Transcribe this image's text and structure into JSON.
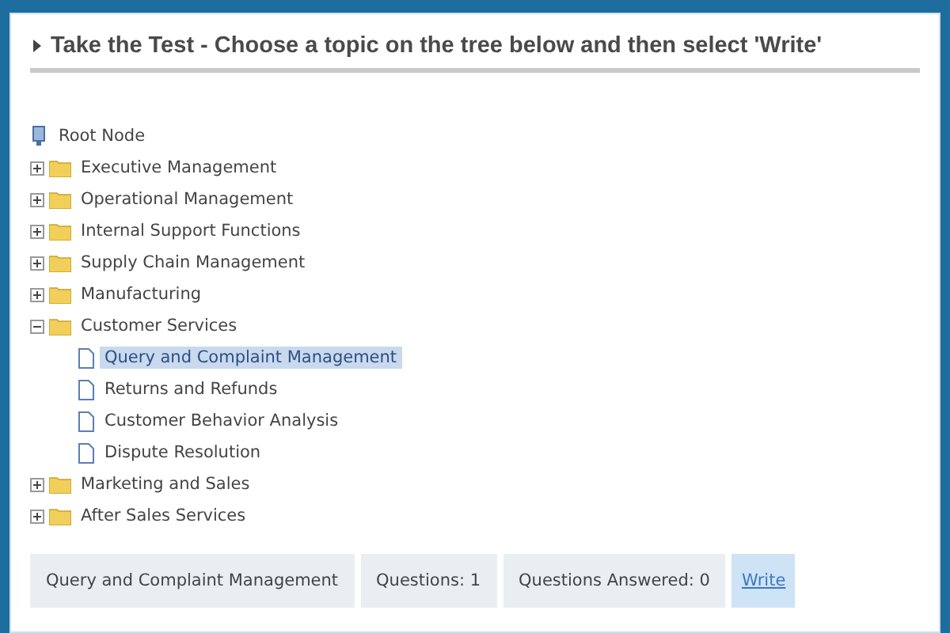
{
  "header": {
    "title": "Take the Test - Choose a topic on the tree below and then select 'Write'"
  },
  "tree": {
    "label": "Root Node",
    "children": [
      {
        "label": "Executive Management",
        "expanded": false
      },
      {
        "label": "Operational Management",
        "expanded": false
      },
      {
        "label": "Internal Support Functions",
        "expanded": false
      },
      {
        "label": "Supply Chain Management",
        "expanded": false
      },
      {
        "label": "Manufacturing",
        "expanded": false
      },
      {
        "label": "Customer Services",
        "expanded": true,
        "children": [
          {
            "label": "Query and Complaint Management",
            "selected": true
          },
          {
            "label": "Returns and Refunds",
            "selected": false
          },
          {
            "label": "Customer Behavior Analysis",
            "selected": false
          },
          {
            "label": "Dispute Resolution",
            "selected": false
          }
        ]
      },
      {
        "label": "Marketing and Sales",
        "expanded": false
      },
      {
        "label": "After Sales Services",
        "expanded": false
      }
    ]
  },
  "status_bar": {
    "topic": "Query and Complaint Management",
    "questions": "Questions: 1",
    "answered": "Questions Answered: 0",
    "write_link": "Write"
  }
}
